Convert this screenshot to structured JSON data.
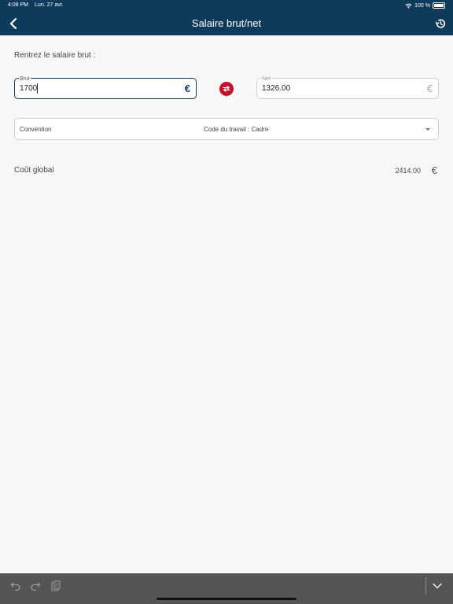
{
  "status_bar": {
    "time": "4:08 PM",
    "date": "Lun. 27 avr.",
    "battery": "100 %",
    "wifi_icon": "wifi-icon"
  },
  "header": {
    "title": "Salaire brut/net",
    "back_icon": "chevron-left-icon",
    "history_icon": "history-icon"
  },
  "main": {
    "prompt": "Rentrez le salaire brut :",
    "brut": {
      "label": "Brut",
      "value": "1700",
      "currency": "€"
    },
    "swap_icon": "swap-arrows-icon",
    "net": {
      "label": "Net",
      "value": "1326.00",
      "currency": "€"
    },
    "convention": {
      "label": "Convention",
      "value": "Code du travail : Cadre"
    },
    "cost": {
      "label": "Coût global",
      "value": "2414.00",
      "currency": "€"
    }
  },
  "keyboard_bar": {
    "undo_icon": "undo-icon",
    "redo_icon": "redo-icon",
    "paste_icon": "clipboard-icon",
    "dismiss_icon": "chevron-down-icon"
  },
  "colors": {
    "header_bg": "#0e3a5c",
    "accent": "#c4102b",
    "background": "#f8f8f8",
    "toolbar_bg": "#555555"
  }
}
